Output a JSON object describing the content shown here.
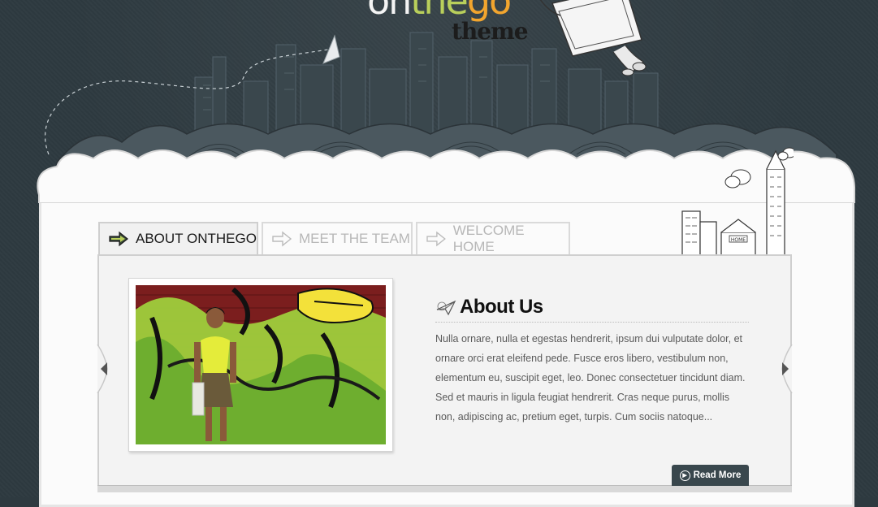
{
  "logo": {
    "part1": "on",
    "part2": "the",
    "part3": "go",
    "sub": "theme"
  },
  "tabs": [
    {
      "label": "ABOUT ONTHEGO",
      "active": true
    },
    {
      "label": "MEET THE TEAM",
      "active": false
    },
    {
      "label": "WELCOME HOME",
      "active": false
    }
  ],
  "content": {
    "title": "About Us",
    "body": "Nulla ornare, nulla et egestas hendrerit, ipsum dui vulputate dolor, et ornare orci erat eleifend pede. Fusce eros libero, vestibulum non, elementum eu, suscipit eget, leo. Donec consectetuer tincidunt diam. Sed et mauris in ligula feugiat hendrerit. Cras neque purus, mollis non, adipiscing ac, pretium eget, turpis. Cum sociis natoque...",
    "read_more": "Read More"
  },
  "icons": {
    "tab_arrow": "arrow-right-icon",
    "heading": "paper-plane-icon",
    "prev": "chevron-left-icon",
    "next": "chevron-right-icon",
    "read_more": "play-circle-icon"
  },
  "colors": {
    "background": "#2e3a40",
    "logo_green": "#b9cf5b",
    "logo_orange": "#f2a52e",
    "button": "#39474d"
  }
}
